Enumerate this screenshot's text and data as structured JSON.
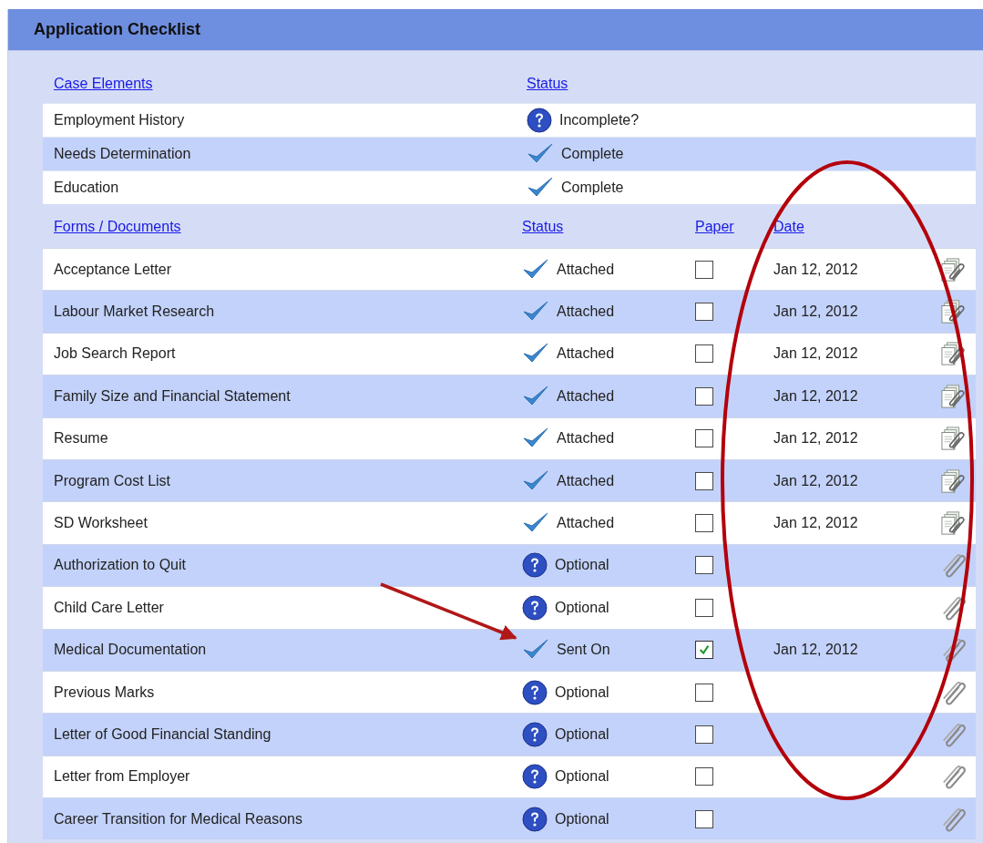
{
  "panel": {
    "title": "Application Checklist"
  },
  "case_section": {
    "columns": [
      "Case Elements",
      "Status"
    ],
    "rows": [
      {
        "name": "Employment History",
        "status": {
          "kind": "question",
          "label": "Incomplete?"
        }
      },
      {
        "name": "Needs Determination",
        "status": {
          "kind": "check",
          "label": "Complete"
        }
      },
      {
        "name": "Education",
        "status": {
          "kind": "check",
          "label": "Complete"
        }
      }
    ]
  },
  "documents_section": {
    "columns": [
      "Forms / Documents",
      "Status",
      "Paper",
      "Date"
    ],
    "rows": [
      {
        "name": "Acceptance Letter",
        "status": {
          "kind": "check",
          "label": "Attached"
        },
        "paper": false,
        "date": "Jan 12, 2012",
        "attachment": {
          "kind": "document"
        }
      },
      {
        "name": "Labour Market Research",
        "status": {
          "kind": "check",
          "label": "Attached"
        },
        "paper": false,
        "date": "Jan 12, 2012",
        "attachment": {
          "kind": "document"
        }
      },
      {
        "name": "Job Search Report",
        "status": {
          "kind": "check",
          "label": "Attached"
        },
        "paper": false,
        "date": "Jan 12, 2012",
        "attachment": {
          "kind": "document"
        }
      },
      {
        "name": "Family Size and Financial Statement",
        "status": {
          "kind": "check",
          "label": "Attached"
        },
        "paper": false,
        "date": "Jan 12, 2012",
        "attachment": {
          "kind": "document"
        }
      },
      {
        "name": "Resume",
        "status": {
          "kind": "check",
          "label": "Attached"
        },
        "paper": false,
        "date": "Jan 12, 2012",
        "attachment": {
          "kind": "document"
        }
      },
      {
        "name": "Program Cost List",
        "status": {
          "kind": "check",
          "label": "Attached"
        },
        "paper": false,
        "date": "Jan 12, 2012",
        "attachment": {
          "kind": "document"
        }
      },
      {
        "name": "SD Worksheet",
        "status": {
          "kind": "check",
          "label": "Attached"
        },
        "paper": false,
        "date": "Jan 12, 2012",
        "attachment": {
          "kind": "document"
        }
      },
      {
        "name": "Authorization to Quit",
        "status": {
          "kind": "question",
          "label": "Optional"
        },
        "paper": false,
        "attachment": {
          "kind": "clip"
        }
      },
      {
        "name": "Child Care Letter",
        "status": {
          "kind": "question",
          "label": "Optional"
        },
        "paper": false,
        "attachment": {
          "kind": "clip"
        }
      },
      {
        "name": "Medical Documentation",
        "status": {
          "kind": "check",
          "label": "Sent On"
        },
        "paper": true,
        "date": "Jan 12, 2012",
        "attachment": {
          "kind": "clip"
        }
      },
      {
        "name": "Previous Marks",
        "status": {
          "kind": "question",
          "label": "Optional"
        },
        "paper": false,
        "attachment": {
          "kind": "clip"
        }
      },
      {
        "name": "Letter of Good Financial Standing",
        "status": {
          "kind": "question",
          "label": "Optional"
        },
        "paper": false,
        "attachment": {
          "kind": "clip"
        }
      },
      {
        "name": "Letter from Employer",
        "status": {
          "kind": "question",
          "label": "Optional"
        },
        "paper": false,
        "attachment": {
          "kind": "clip"
        }
      },
      {
        "name": "Career Transition for Medical Reasons",
        "status": {
          "kind": "question",
          "label": "Optional"
        },
        "paper": false,
        "attachment": {
          "kind": "clip"
        }
      }
    ]
  }
}
